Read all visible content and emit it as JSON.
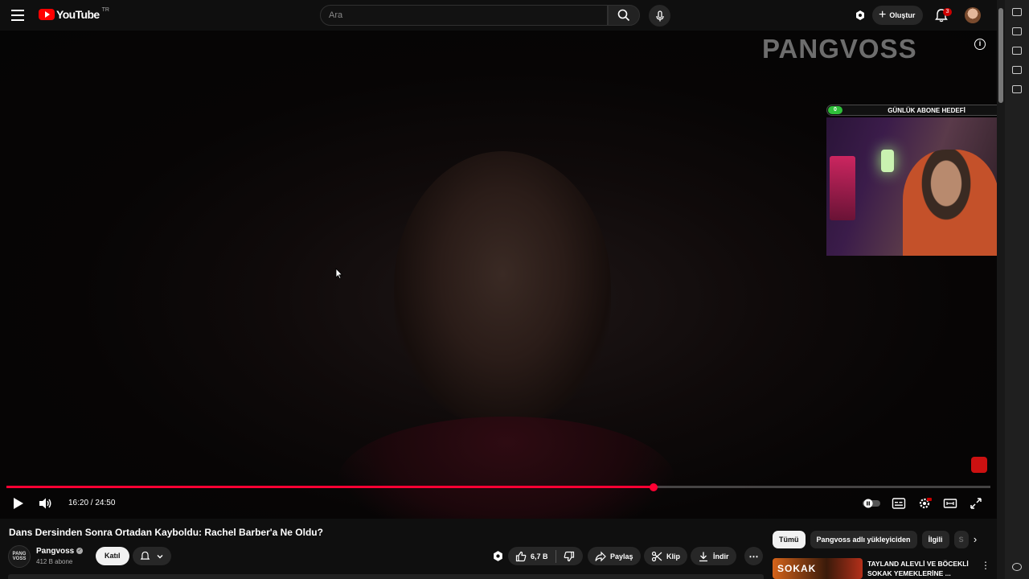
{
  "header": {
    "logo_text": "YouTube",
    "country_code": "TR",
    "search_placeholder": "Ara",
    "create_label": "Oluştur",
    "notification_count": "3"
  },
  "player": {
    "watermark": "PANGVOSS",
    "subscriber_goal": {
      "label": "GÜNLÜK ABONE HEDEFİ",
      "current": "0",
      "target": "6"
    },
    "current_time": "16:20",
    "duration": "24:50",
    "time_display": "16:20 / 24:50",
    "progress": 0.658
  },
  "video": {
    "title": "Dans Dersinden Sonra Ortadan Kayboldu: Rachel Barber'a Ne Oldu?",
    "channel_name": "Pangvoss",
    "channel_avatar_text": "PANG VOSS",
    "subscribers": "412 B abone",
    "join_label": "Katıl",
    "like_count": "6,7 B",
    "share_label": "Paylaş",
    "clip_label": "Klip",
    "download_label": "İndir"
  },
  "recommendations": {
    "chips": [
      "Tümü",
      "Pangvoss adlı yükleyiciden",
      "İlgili",
      "S"
    ],
    "active_chip": 0,
    "first_item": {
      "title": "TAYLAND ALEVLİ VE BÖCEKLİ SOKAK YEMEKLERİNE ...",
      "thumb_text": "SOKAK"
    }
  },
  "colors": {
    "accent": "#ff0033",
    "background": "#0f0f0f",
    "chip_bg": "#272727",
    "goal_green": "#2fbf3a"
  }
}
